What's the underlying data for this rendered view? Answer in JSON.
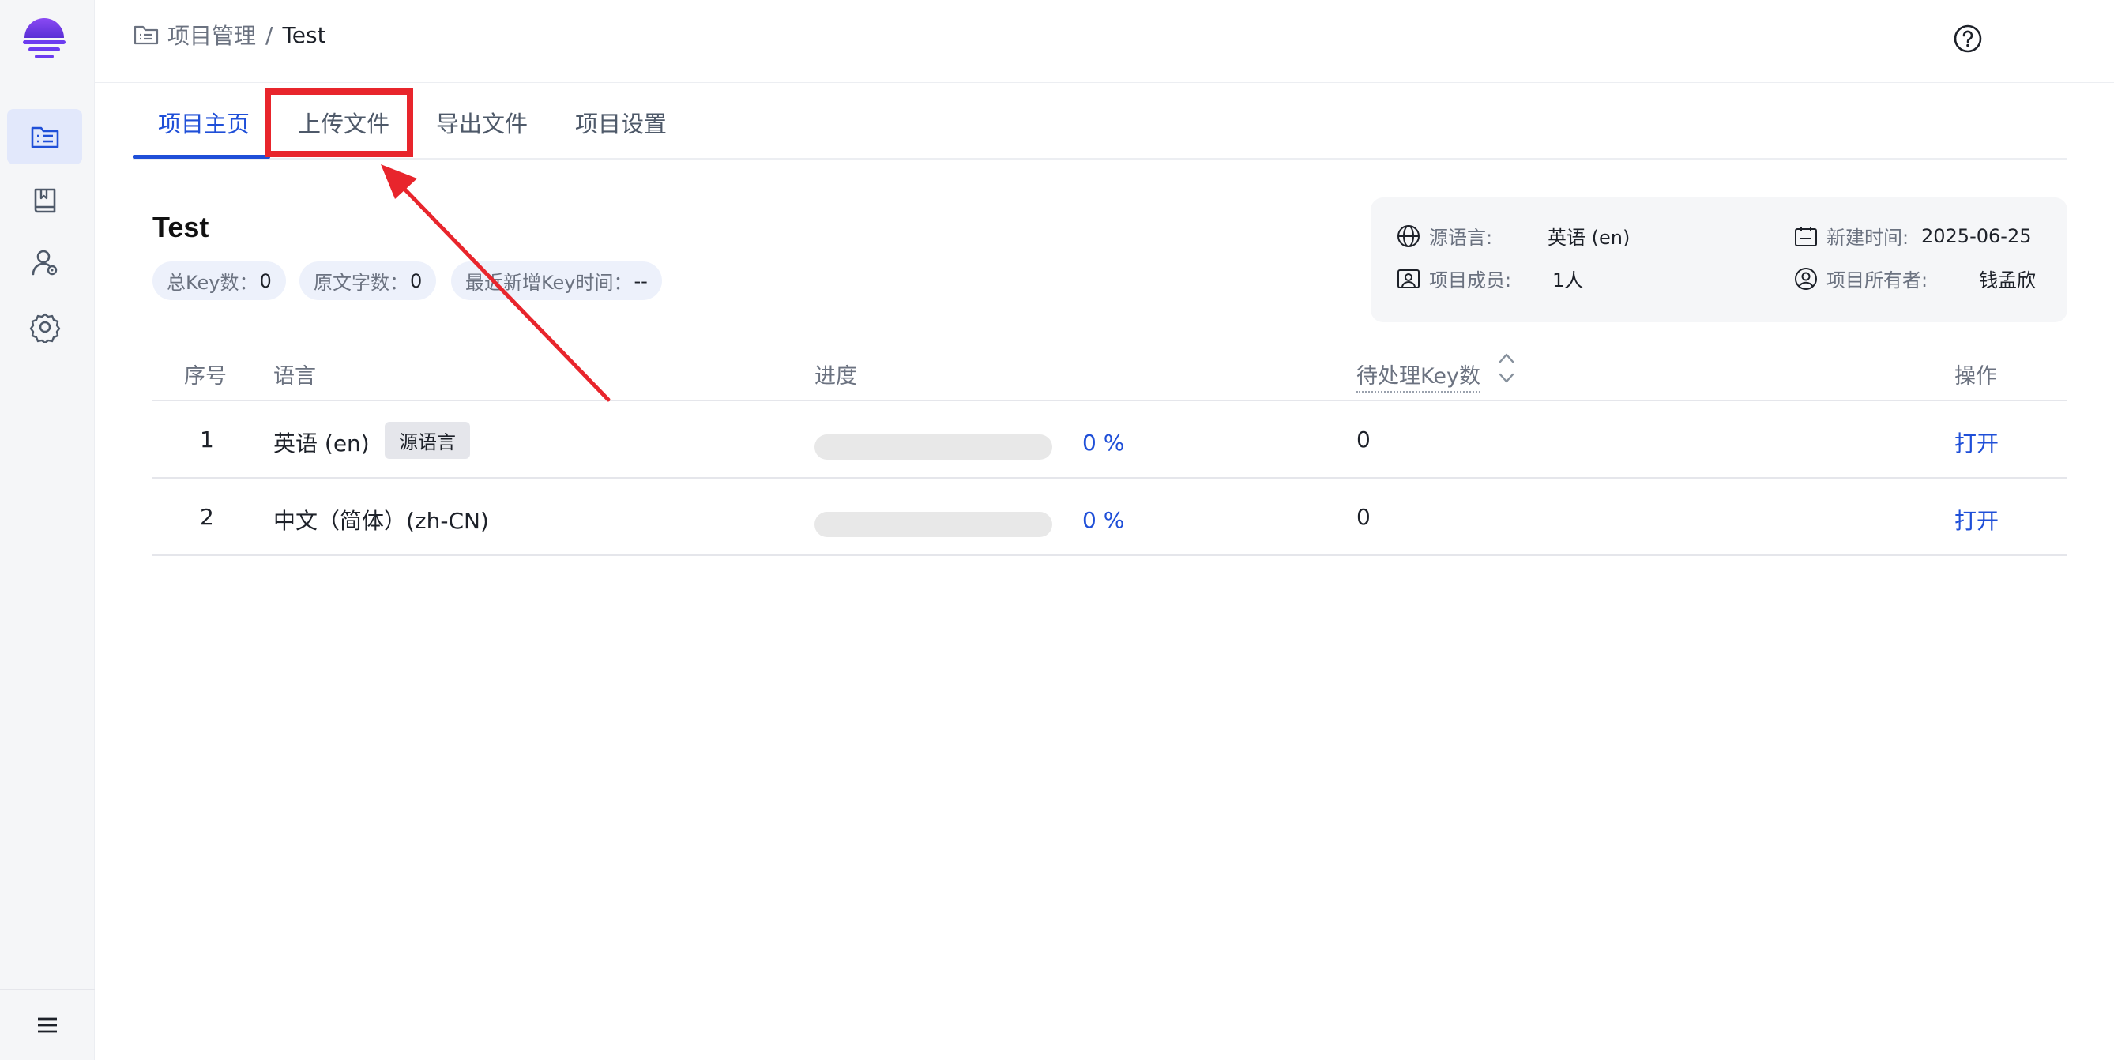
{
  "colors": {
    "accent": "#1f4fd8",
    "annotation": "#e8252c",
    "logo": "#6c3cf0"
  },
  "sidebar": {
    "items": [
      {
        "icon": "project-list-icon",
        "active": true
      },
      {
        "icon": "book-icon",
        "active": false
      },
      {
        "icon": "user-settings-icon",
        "active": false
      },
      {
        "icon": "gear-icon",
        "active": false
      }
    ],
    "bottom_icon": "menu-icon"
  },
  "header": {
    "breadcrumb_parent": "项目管理",
    "breadcrumb_sep": "/",
    "breadcrumb_current": "Test",
    "help_icon": "help-circle-icon"
  },
  "tabs": [
    {
      "label": "项目主页",
      "active": true
    },
    {
      "label": "上传文件",
      "active": false,
      "highlighted": true
    },
    {
      "label": "导出文件",
      "active": false
    },
    {
      "label": "项目设置",
      "active": false
    }
  ],
  "project": {
    "title": "Test",
    "stats": [
      {
        "label": "总Key数：",
        "value": "0"
      },
      {
        "label": "原文字数：",
        "value": "0"
      },
      {
        "label": "最近新增Key时间：",
        "value": "--"
      }
    ],
    "info": {
      "source_lang_label": "源语言:",
      "source_lang_value": "英语 (en)",
      "created_label": "新建时间:",
      "created_value": "2025-06-25",
      "members_label": "项目成员:",
      "members_value": "1人",
      "owner_label": "项目所有者:",
      "owner_value": "钱孟欣"
    }
  },
  "table": {
    "headers": {
      "index": "序号",
      "language": "语言",
      "progress": "进度",
      "pending": "待处理Key数",
      "actions": "操作"
    },
    "rows": [
      {
        "index": "1",
        "language": "英语 (en)",
        "badge": "源语言",
        "progress": 0,
        "progress_text": "0 %",
        "pending": "0",
        "action": "打开"
      },
      {
        "index": "2",
        "language": "中文（简体）(zh-CN)",
        "progress": 0,
        "progress_text": "0 %",
        "pending": "0",
        "action": "打开"
      }
    ]
  }
}
